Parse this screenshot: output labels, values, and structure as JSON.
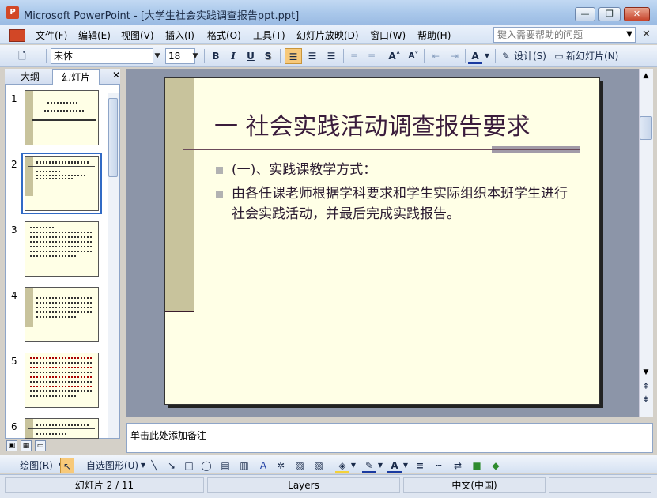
{
  "window": {
    "title": "Microsoft PowerPoint - [大学生社会实践调查报告ppt.ppt]",
    "app_icon": "P",
    "minimize_label": "—",
    "restore_label": "❐",
    "close_label": "✕"
  },
  "menu": {
    "items": [
      "文件(F)",
      "编辑(E)",
      "视图(V)",
      "插入(I)",
      "格式(O)",
      "工具(T)",
      "幻灯片放映(D)",
      "窗口(W)",
      "帮助(H)"
    ],
    "help_placeholder": "键入需要帮助的问题",
    "doc_close": "✕"
  },
  "toolbar": {
    "font_name": "宋体",
    "font_size": "18",
    "bold": "B",
    "italic": "I",
    "underline": "U",
    "shadow": "S",
    "design_label": "设计(S)",
    "new_slide_label": "新幻灯片(N)"
  },
  "panel": {
    "tabs": [
      "大纲",
      "幻灯片"
    ],
    "close": "✕",
    "slide_numbers": [
      "1",
      "2",
      "3",
      "4",
      "5",
      "6"
    ],
    "selected_slide": 2
  },
  "slide": {
    "title": "一 社会实践活动调查报告要求",
    "bullets": [
      "(一)、实践课教学方式：",
      "由各任课老师根据学科要求和学生实际组织本班学生进行社会实践活动，并最后完成实践报告。"
    ]
  },
  "notes": {
    "placeholder": "单击此处添加备注"
  },
  "drawing": {
    "draw_label": "绘图(R)",
    "autoshapes_label": "自选图形(U)"
  },
  "status": {
    "slide_indicator": "幻灯片 2 / 11",
    "design": "Layers",
    "language": "中文(中国)"
  },
  "colors": {
    "slide_background": "#ffffe6",
    "slide_accent": "#c8c39c",
    "title_color": "#3a1c3c"
  }
}
